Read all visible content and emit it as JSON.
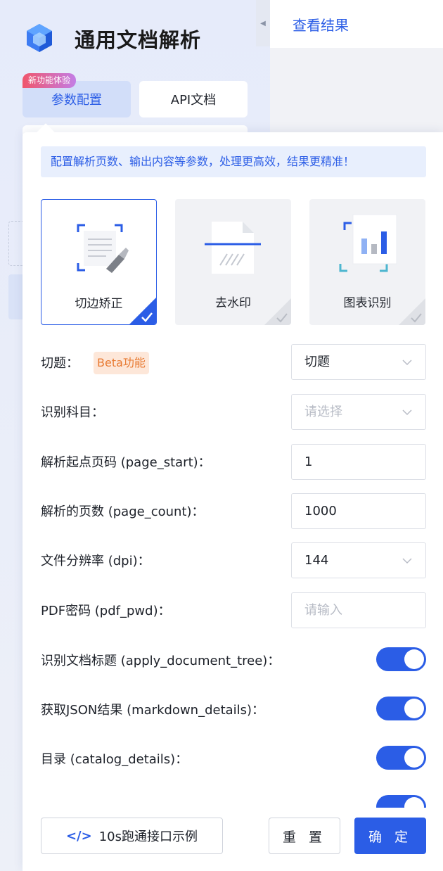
{
  "app": {
    "title": "通用文档解析"
  },
  "nav": {
    "params_tab": "参数配置",
    "params_badge": "新功能体验",
    "api_tab": "API文档",
    "result_tab": "查看结果"
  },
  "colors": {
    "accent": "#2b5de6",
    "beta_bg": "#fde7d9",
    "beta_text": "#e87a32"
  },
  "config": {
    "notice": "配置解析页数、输出内容等参数，处理更高效，结果更精准！",
    "features": [
      {
        "label": "切边矫正",
        "icon": "crop-correct-icon",
        "selected": true
      },
      {
        "label": "去水印",
        "icon": "remove-watermark-icon",
        "selected": false
      },
      {
        "label": "图表识别",
        "icon": "chart-recognition-icon",
        "selected": false
      }
    ],
    "fields": {
      "cut_question": {
        "label": "切题：",
        "beta": "Beta功能",
        "value": "切题"
      },
      "subject": {
        "label": "识别科目：",
        "placeholder": "请选择"
      },
      "page_start": {
        "label": "解析起点页码 (page_start)：",
        "value": "1"
      },
      "page_count": {
        "label": "解析的页数 (page_count)：",
        "value": "1000"
      },
      "dpi": {
        "label": "文件分辨率 (dpi)：",
        "value": "144"
      },
      "pdf_pwd": {
        "label": "PDF密码 (pdf_pwd)：",
        "placeholder": "请输入"
      }
    },
    "toggles": [
      {
        "label": "识别文档标题 (apply_document_tree)：",
        "on": true
      },
      {
        "label": "获取JSON结果 (markdown_details)：",
        "on": true
      },
      {
        "label": "目录 (catalog_details)：",
        "on": true
      }
    ]
  },
  "footer": {
    "example_button": "10s跑通接口示例",
    "reset_button": "重 置",
    "confirm_button": "确 定"
  }
}
